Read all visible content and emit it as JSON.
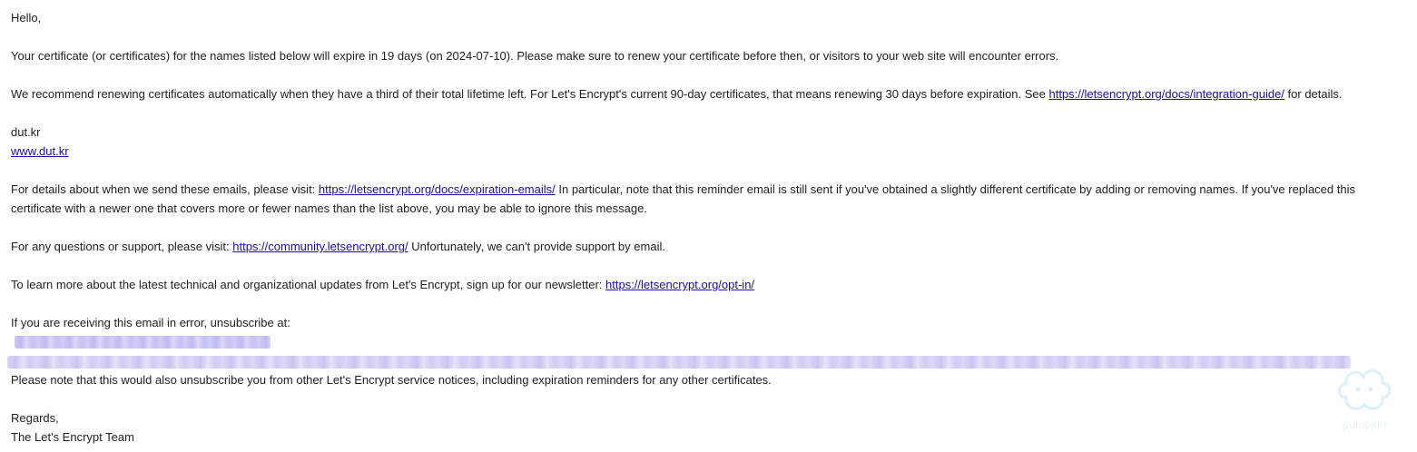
{
  "email": {
    "greeting": "Hello,",
    "p1": "Your certificate (or certificates) for the names listed below will expire in 19 days (on 2024-07-10). Please make sure to renew your certificate before then, or visitors to your web site will encounter errors.",
    "p2_before": "We recommend renewing certificates automatically when they have a third of their total lifetime left. For Let's Encrypt's current 90-day certificates, that means renewing 30 days before expiration. See ",
    "p2_link": "https://letsencrypt.org/docs/integration-guide/",
    "p2_after": " for details.",
    "domain_plain": "dut.kr",
    "domain_link": "www.dut.kr",
    "p3_before": "For details about when we send these emails, please visit: ",
    "p3_link": "https://letsencrypt.org/docs/expiration-emails/",
    "p3_after": " In particular, note that this reminder email is still sent if you've obtained a slightly different certificate by adding or removing names. If you've replaced this certificate with a newer one that covers more or fewer names than the list above, you may be able to ignore this message.",
    "p4_before": "For any questions or support, please visit: ",
    "p4_link": "https://community.letsencrypt.org/",
    "p4_after": " Unfortunately, we can't provide support by email.",
    "p5_before": "To learn more about the latest technical and organizational updates from Let's Encrypt, sign up for our newsletter: ",
    "p5_link": "https://letsencrypt.org/opt-in/",
    "p6": "If you are receiving this email in error, unsubscribe at:",
    "p7": "Please note that this would also unsubscribe you from other Let's Encrypt service notices, including expiration reminders for any other certificates.",
    "regards": "Regards,",
    "signature": "The Let's Encrypt Team"
  },
  "watermark": {
    "text": "pumpkin",
    "icon": "cloud-face-icon"
  }
}
